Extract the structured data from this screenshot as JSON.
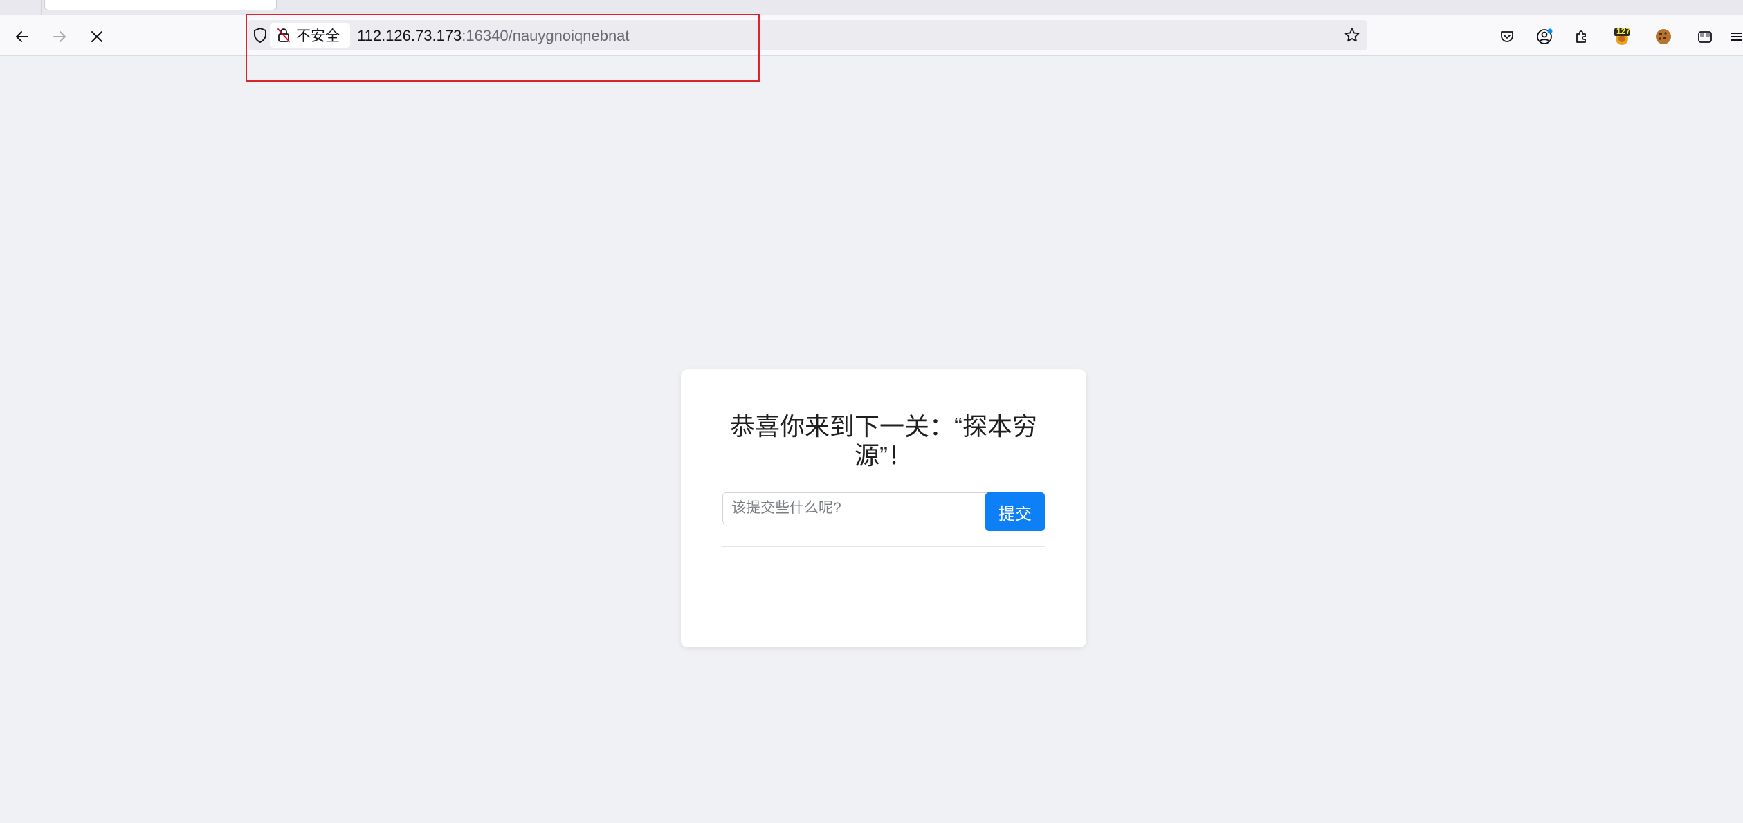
{
  "browser": {
    "address_bar": {
      "security_label": "不安全",
      "url_host": "112.126.73.173",
      "url_rest": ":16340/nauygnoiqnebnat"
    },
    "extension_badge": "127",
    "colors": {
      "annotation_box": "#d9262d",
      "accent": "#0d7ff7"
    }
  },
  "page": {
    "title": "恭喜你来到下一关：“探本穷源”！",
    "input": {
      "placeholder": "该提交些什么呢?",
      "value": ""
    },
    "submit_label": "提交"
  }
}
